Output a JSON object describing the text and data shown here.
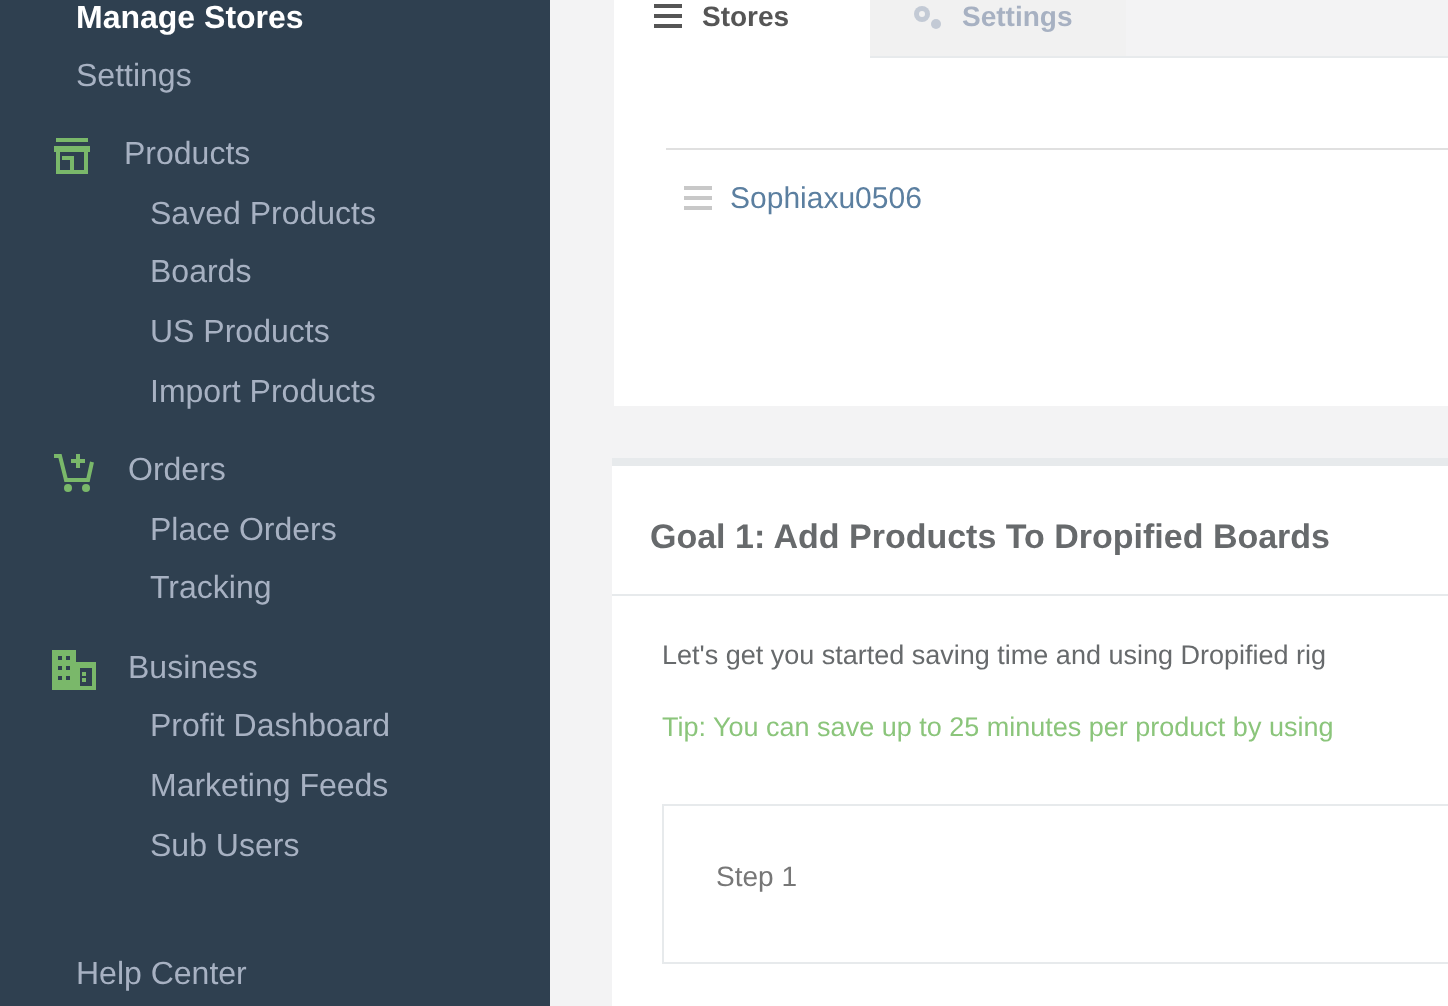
{
  "sidebar": {
    "items": [
      {
        "kind": "link",
        "label": "Manage Stores",
        "selected": true
      },
      {
        "kind": "link",
        "label": "Settings",
        "selected": false
      },
      {
        "kind": "section",
        "label": "Products",
        "children": [
          {
            "label": "Saved Products"
          },
          {
            "label": "Boards"
          },
          {
            "label": "US Products"
          },
          {
            "label": "Import Products"
          }
        ]
      },
      {
        "kind": "section",
        "label": "Orders",
        "children": [
          {
            "label": "Place Orders"
          },
          {
            "label": "Tracking"
          }
        ]
      },
      {
        "kind": "section",
        "label": "Business",
        "children": [
          {
            "label": "Profit Dashboard"
          },
          {
            "label": "Marketing Feeds"
          },
          {
            "label": "Sub Users"
          }
        ]
      },
      {
        "kind": "help",
        "label": "Help Center",
        "selected": false
      }
    ]
  },
  "stores_panel": {
    "tabs": [
      {
        "label": "Stores",
        "selected": true
      },
      {
        "label": "Settings",
        "selected": false
      }
    ],
    "stores": [
      "Sophiaxu0506"
    ]
  },
  "goal_card": {
    "title": "Goal 1: Add Products To Dropified Boards",
    "intro": "Let's get you started saving time and using Dropified rig",
    "tip": "Tip: You can save up to 25 minutes per product by using",
    "steps": [
      "Step 1"
    ]
  }
}
